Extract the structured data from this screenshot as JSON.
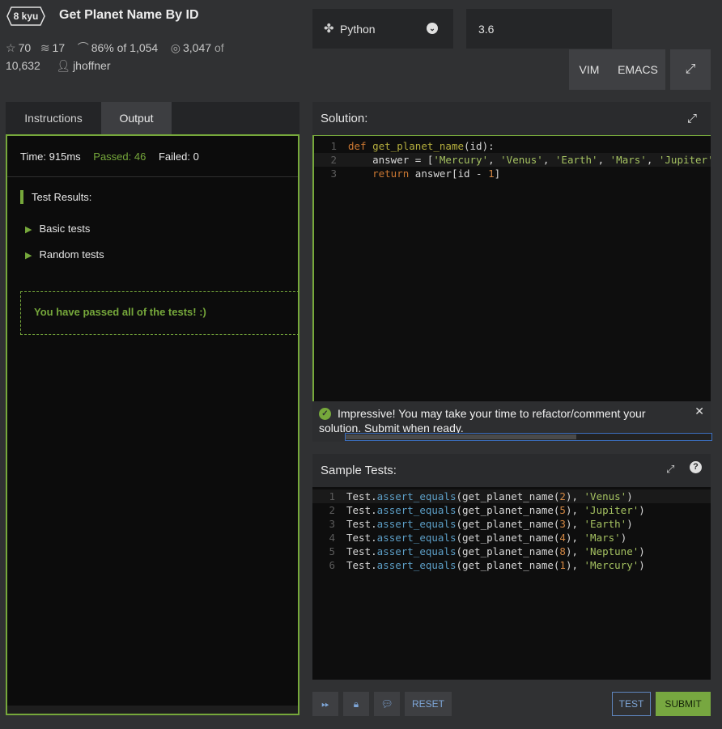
{
  "kata": {
    "rank": "8 kyu",
    "title": "Get Planet Name By ID"
  },
  "stats": {
    "stars": "70",
    "collections": "17",
    "satisfaction": "86%",
    "satisfaction_of": "of 1,054",
    "completed": "3,047",
    "completed_of": "of",
    "completed_total": "10,632",
    "author": "jhoffner"
  },
  "language": {
    "name": "Python",
    "version": "3.6"
  },
  "keybindings": {
    "vim": "VIM",
    "emacs": "EMACS"
  },
  "tabs": {
    "instructions": "Instructions",
    "output": "Output"
  },
  "output": {
    "time": "Time: 915ms",
    "passed": "Passed: 46",
    "failed": "Failed: 0",
    "results_header": "Test Results:",
    "groups": [
      "Basic tests",
      "Random tests"
    ],
    "passed_message": "You have passed all of the tests! :)"
  },
  "solution": {
    "label": "Solution:"
  },
  "notification": {
    "message": "Impressive! You may take your time to refactor/comment your solution. Submit when ready."
  },
  "sample_tests": {
    "label": "Sample Tests:"
  },
  "actions": {
    "reset": "RESET",
    "test": "TEST",
    "submit": "SUBMIT"
  },
  "colors": {
    "accent_green": "#76a83b",
    "accent_blue": "#7ea6d8",
    "background": "#303133"
  }
}
